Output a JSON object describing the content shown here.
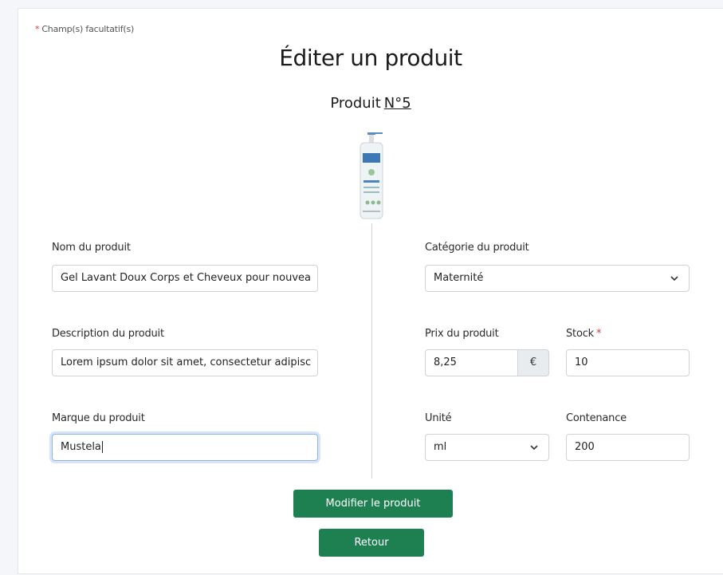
{
  "form": {
    "optional_marker": "*",
    "optional_note": "Champ(s) facultatif(s)",
    "title": "Éditer un produit",
    "product_label": "Produit",
    "product_number": "N°5"
  },
  "fields": {
    "name": {
      "label": "Nom du produit",
      "value": "Gel Lavant Doux Corps et Cheveux pour nouvea"
    },
    "description": {
      "label": "Description du produit",
      "value": "Lorem ipsum dolor sit amet, consectetur adipisc"
    },
    "brand": {
      "label": "Marque du produit",
      "value": "Mustela"
    },
    "category": {
      "label": "Catégorie du produit",
      "selected": "Maternité"
    },
    "price": {
      "label": "Prix du produit",
      "value": "8,25",
      "currency": "€"
    },
    "stock": {
      "label": "Stock",
      "required_marker": "*",
      "value": "10"
    },
    "unit": {
      "label": "Unité",
      "selected": "ml"
    },
    "content": {
      "label": "Contenance",
      "value": "200"
    }
  },
  "buttons": {
    "submit": "Modifier le produit",
    "back": "Retour"
  },
  "colors": {
    "primary": "#1e8050",
    "required": "#d93a3a",
    "focus": "#8fb3e6"
  }
}
